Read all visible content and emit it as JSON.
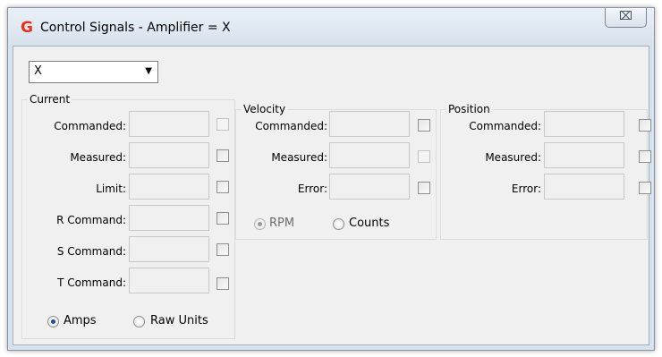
{
  "window": {
    "title": "Control Signals - Amplifier = X",
    "close_glyph": "⌧"
  },
  "axis_select": {
    "value": "X"
  },
  "current": {
    "title": "Current",
    "fields": [
      {
        "label": "Commanded:",
        "value": ""
      },
      {
        "label": "Measured:",
        "value": ""
      },
      {
        "label": "Limit:",
        "value": ""
      },
      {
        "label": "R Command:",
        "value": ""
      },
      {
        "label": "S Command:",
        "value": ""
      },
      {
        "label": "T Command:",
        "value": ""
      }
    ],
    "units": [
      {
        "label": "Amps",
        "checked": true
      },
      {
        "label": "Raw Units",
        "checked": false
      }
    ]
  },
  "velocity": {
    "title": "Velocity",
    "fields": [
      {
        "label": "Commanded:",
        "value": ""
      },
      {
        "label": "Measured:",
        "value": ""
      },
      {
        "label": "Error:",
        "value": ""
      }
    ],
    "units": [
      {
        "label": "RPM",
        "checked": true
      },
      {
        "label": "Counts",
        "checked": false
      }
    ]
  },
  "position": {
    "title": "Position",
    "fields": [
      {
        "label": "Commanded:",
        "value": ""
      },
      {
        "label": "Measured:",
        "value": ""
      },
      {
        "label": "Error:",
        "value": ""
      }
    ]
  },
  "colors": {
    "title_icon": "#e8311a",
    "radio_selected": "#1c4f95"
  },
  "icons": {
    "app": "g-logo-icon",
    "close": "close-icon",
    "dropdown": "chevron-down-icon"
  }
}
